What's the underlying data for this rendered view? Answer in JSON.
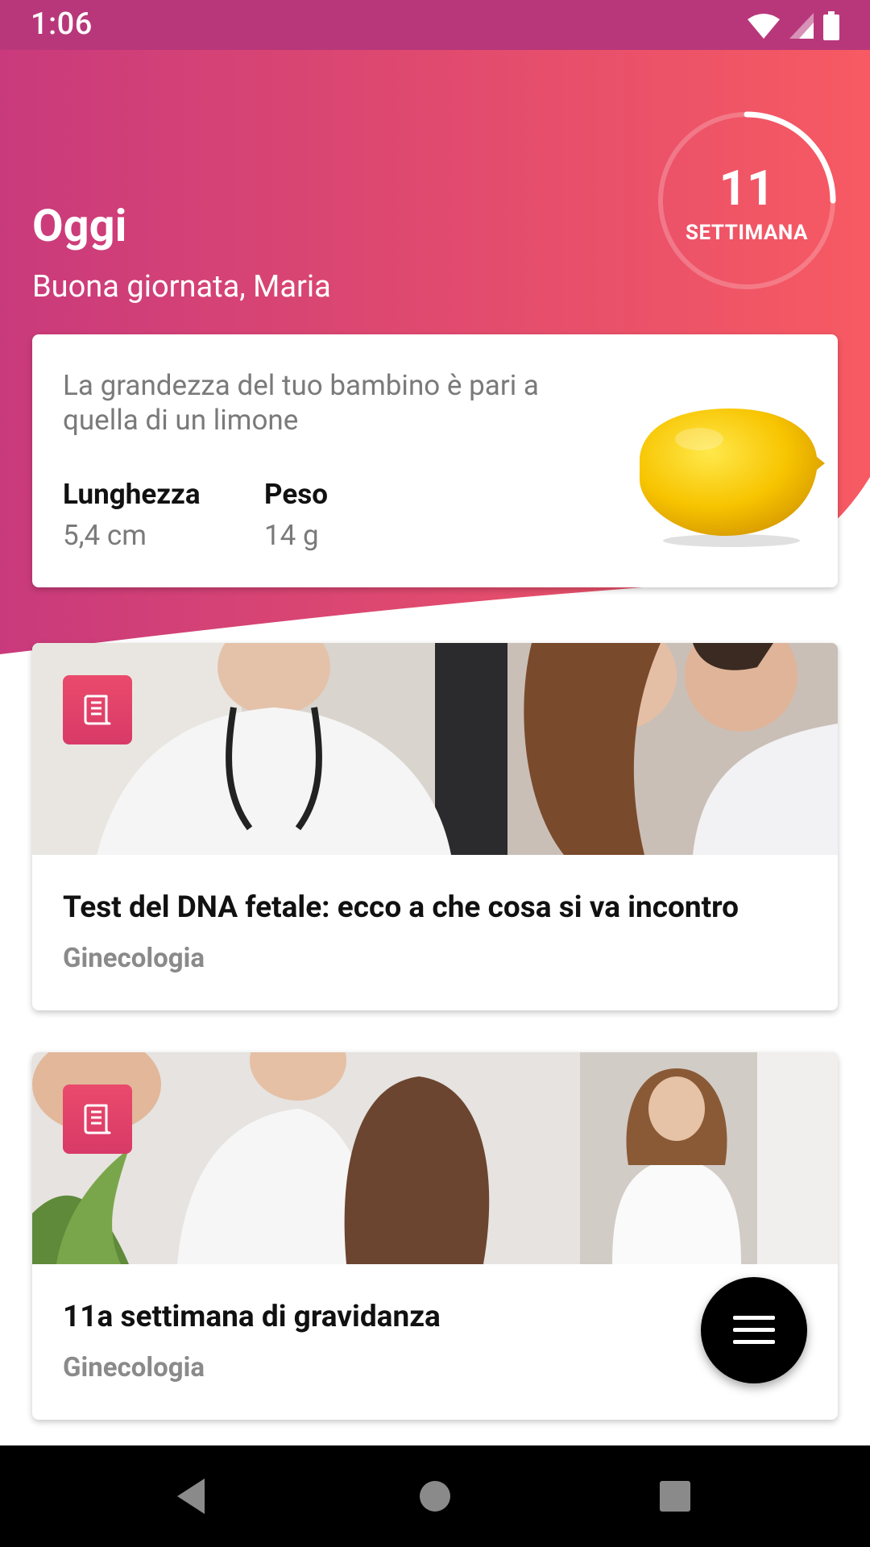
{
  "status": {
    "time": "1:06",
    "icons": [
      "wifi-icon",
      "signal-icon",
      "battery-icon"
    ]
  },
  "header": {
    "title": "Oggi",
    "greeting": "Buona giornata, Maria",
    "week": {
      "number": "11",
      "label": "SETTIMANA",
      "progress": 0.27
    },
    "colors": {
      "gradient_start": "#c93a7c",
      "gradient_end": "#f75a62"
    }
  },
  "baby_size": {
    "description": "La grandezza del tuo bambino è pari a quella di un limone",
    "length_label": "Lunghezza",
    "length_value": "5,4 cm",
    "weight_label": "Peso",
    "weight_value": "14 g",
    "image": "lemon"
  },
  "articles": [
    {
      "title": "Test del DNA fetale: ecco a che cosa si va incontro",
      "category": "Ginecologia",
      "icon": "article-icon"
    },
    {
      "title": "11a settimana di gravidanza",
      "category": "Ginecologia",
      "icon": "article-icon"
    }
  ],
  "fab": {
    "icon": "menu-icon"
  },
  "navigation": {
    "icons": [
      "back-icon",
      "home-icon",
      "recents-icon"
    ]
  }
}
